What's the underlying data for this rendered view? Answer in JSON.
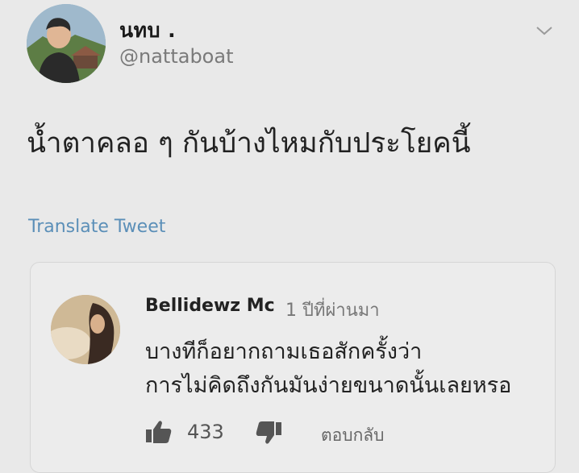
{
  "tweet": {
    "display_name": "นทบ .",
    "handle": "@nattaboat",
    "text": "น้ำตาคลอ ๆ กันบ้างไหมกับประโยคนี้",
    "translate_label": "Translate Tweet",
    "avatar_icon": "profile-photo",
    "menu_icon": "chevron-down"
  },
  "reply": {
    "author": "Bellidewz Mc",
    "time": "1 ปีที่ผ่านมา",
    "lines": [
      "บางทีก็อยากถามเธอสักครั้งว่า",
      "การไม่คิดถึงกันมันง่ายขนาดนั้นเลยหรอ"
    ],
    "likes": "433",
    "like_icon": "thumbs-up",
    "dislike_icon": "thumbs-down",
    "reply_label": "ตอบกลับ"
  },
  "colors": {
    "background": "#e9e9e9",
    "link": "#5b8fb8",
    "secondary_text": "#7a7a7a"
  }
}
